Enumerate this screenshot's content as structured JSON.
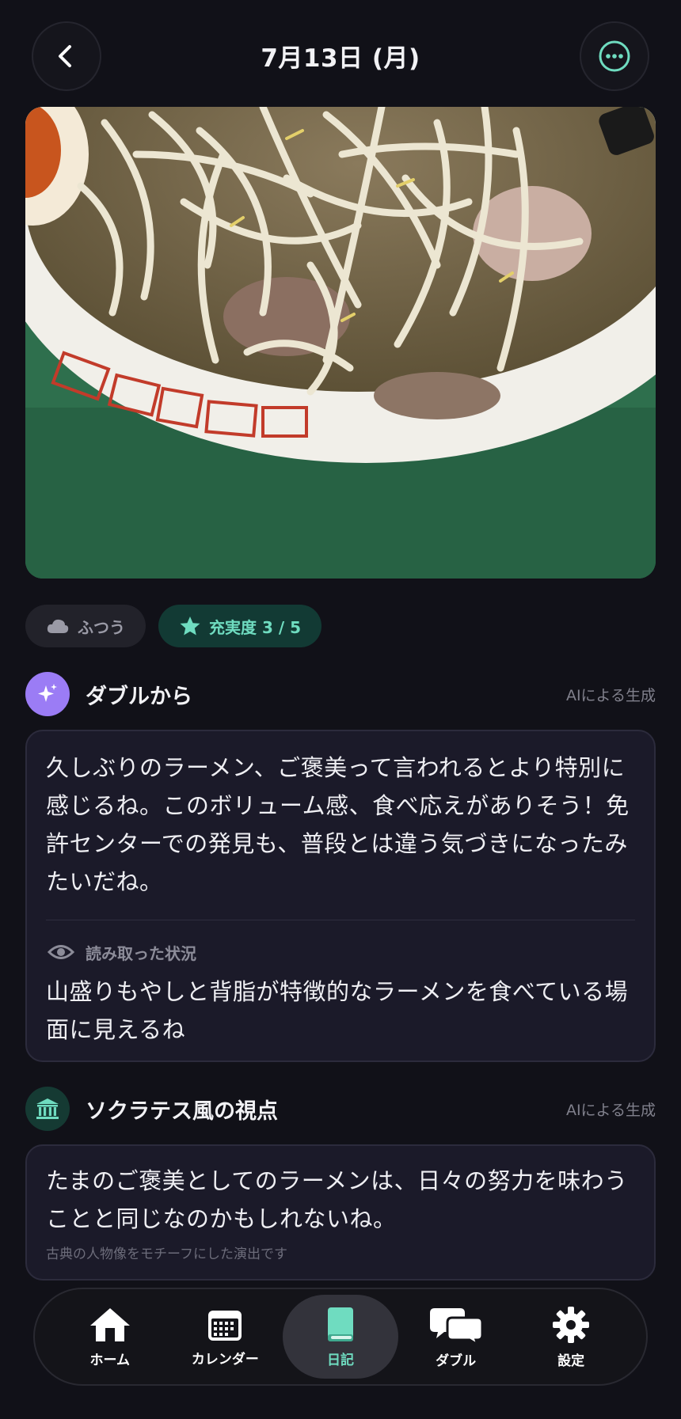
{
  "header": {
    "title": "7月13日 (月)",
    "back_icon": "chevron-left-icon",
    "more_icon": "ellipsis-circle-icon"
  },
  "photo": {
    "icon": "ramen-photo"
  },
  "chips": {
    "weather_icon": "cloud-icon",
    "weather_label": "ふつう",
    "rating_icon": "star-icon",
    "rating_label": "充実度 3 / 5",
    "rating_value": 3,
    "rating_max": 5
  },
  "double_section": {
    "icon": "sparkles-icon",
    "title": "ダブルから",
    "tag": "AIによる生成",
    "message": "久しぶりのラーメン、ご褒美って言われるとより特別に感じるね。このボリューム感、食べ応えがありそう！免許センターでの発見も、普段とは違う気づきになったみたいだね。",
    "observation_icon": "eye-icon",
    "observation_label": "読み取った状況",
    "observation": "山盛りもやしと背脂が特徴的なラーメンを食べている場面に見えるね"
  },
  "socrates_section": {
    "icon": "classical-building-icon",
    "title": "ソクラテス風の視点",
    "tag": "AIによる生成",
    "message": "たまのご褒美としてのラーメンは、日々の努力を味わうことと同じなのかもしれないね。",
    "note": "古典の人物像をモチーフにした演出です"
  },
  "nav": {
    "items": [
      {
        "label": "ホーム",
        "icon": "home-icon"
      },
      {
        "label": "カレンダー",
        "icon": "calendar-icon"
      },
      {
        "label": "日記",
        "icon": "book-icon",
        "active": true
      },
      {
        "label": "ダブル",
        "icon": "chat-bubbles-icon"
      },
      {
        "label": "設定",
        "icon": "gear-icon"
      }
    ]
  },
  "colors": {
    "background": "#111118",
    "accent": "#6fdcc0",
    "card": "#1b1a29",
    "sparkle": "#9b7cf5"
  }
}
